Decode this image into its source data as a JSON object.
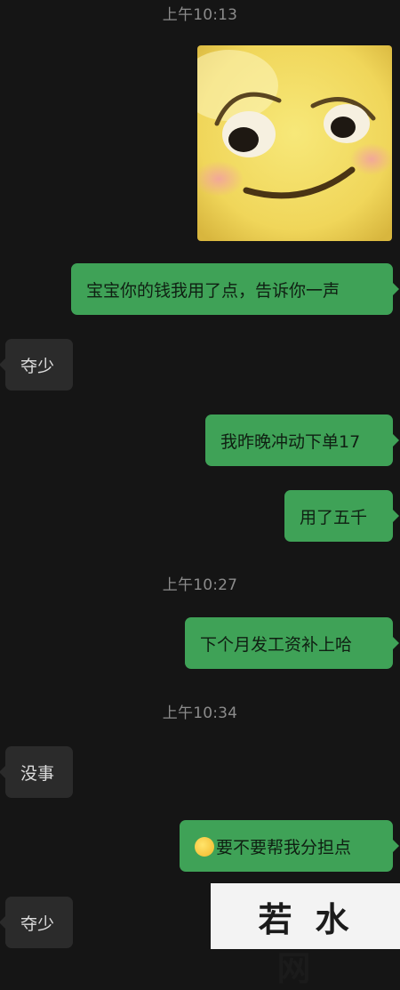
{
  "timestamps": [
    "上午10:13",
    "上午10:27",
    "上午10:34"
  ],
  "messages": [
    {
      "side": "out",
      "text": "宝宝你的钱我用了点，告诉你一声"
    },
    {
      "side": "in",
      "text": "夺少"
    },
    {
      "side": "out",
      "text": "我昨晚冲动下单17"
    },
    {
      "side": "out",
      "text": "用了五千"
    },
    {
      "side": "out",
      "text": "下个月发工资补上哈"
    },
    {
      "side": "in",
      "text": "没事"
    },
    {
      "side": "out",
      "text": "要不要帮我分担点"
    },
    {
      "side": "in",
      "text": "夺少"
    }
  ],
  "sticker": {
    "icon": "smirking-smiley-face-sticker"
  },
  "inline_emoji": {
    "icon": "blushing-emoji-icon"
  },
  "watermark": {
    "text": "若水网"
  },
  "colors": {
    "background": "#151515",
    "outgoing": "#3fa257",
    "incoming": "#2b2b2b",
    "timestamp": "#8b8b8b"
  }
}
